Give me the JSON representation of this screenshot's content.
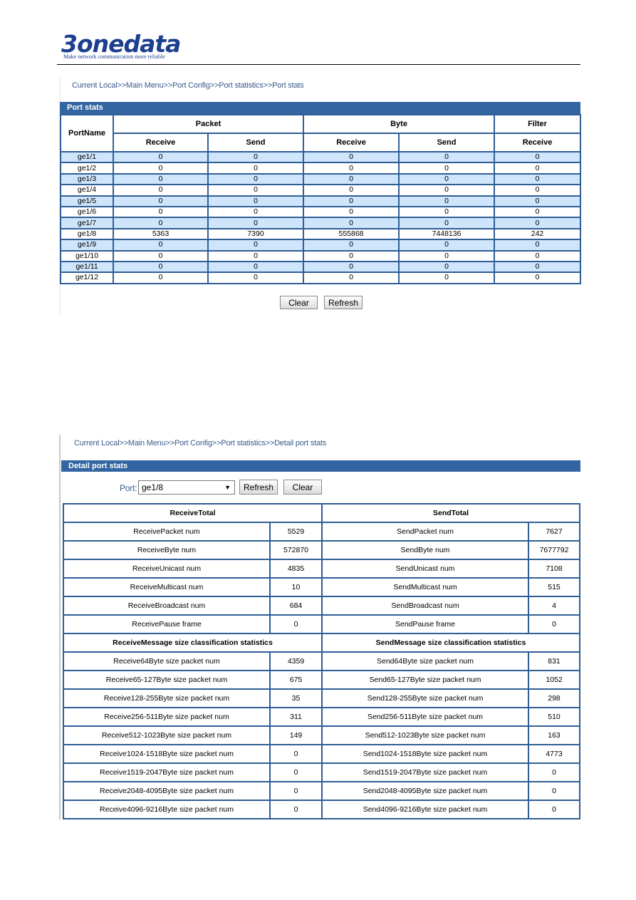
{
  "logo": {
    "brand": "3onedata",
    "tagline": "Make network communication more reliable"
  },
  "port_stats": {
    "breadcrumb": "Current Local>>Main Menu>>Port Config>>Port statistics>>Port stats",
    "title": "Port stats",
    "headers": {
      "port_name": "PortName",
      "packet": "Packet",
      "byte": "Byte",
      "filter": "Filter",
      "receive": "Receive",
      "send": "Send"
    },
    "rows": [
      [
        "ge1/1",
        "0",
        "0",
        "0",
        "0",
        "0"
      ],
      [
        "ge1/2",
        "0",
        "0",
        "0",
        "0",
        "0"
      ],
      [
        "ge1/3",
        "0",
        "0",
        "0",
        "0",
        "0"
      ],
      [
        "ge1/4",
        "0",
        "0",
        "0",
        "0",
        "0"
      ],
      [
        "ge1/5",
        "0",
        "0",
        "0",
        "0",
        "0"
      ],
      [
        "ge1/6",
        "0",
        "0",
        "0",
        "0",
        "0"
      ],
      [
        "ge1/7",
        "0",
        "0",
        "0",
        "0",
        "0"
      ],
      [
        "ge1/8",
        "5363",
        "7390",
        "555868",
        "7448136",
        "242"
      ],
      [
        "ge1/9",
        "0",
        "0",
        "0",
        "0",
        "0"
      ],
      [
        "ge1/10",
        "0",
        "0",
        "0",
        "0",
        "0"
      ],
      [
        "ge1/11",
        "0",
        "0",
        "0",
        "0",
        "0"
      ],
      [
        "ge1/12",
        "0",
        "0",
        "0",
        "0",
        "0"
      ]
    ],
    "clear_label": "Clear",
    "refresh_label": "Refresh"
  },
  "detail": {
    "breadcrumb": "Current Local>>Main Menu>>Port Config>>Port statistics>>Detail port stats",
    "title": "Detail port stats",
    "port_label": "Port:",
    "port_value": "ge1/8",
    "refresh_label": "Refresh",
    "clear_label": "Clear",
    "rows": [
      {
        "header": true,
        "left": "ReceiveTotal",
        "right": "SendTotal"
      },
      {
        "left": "ReceivePacket num",
        "lv": "5529",
        "right": "SendPacket num",
        "rv": "7627"
      },
      {
        "left": "ReceiveByte num",
        "lv": "572870",
        "right": "SendByte num",
        "rv": "7677792"
      },
      {
        "left": "ReceiveUnicast num",
        "lv": "4835",
        "right": "SendUnicast num",
        "rv": "7108"
      },
      {
        "left": "ReceiveMulticast num",
        "lv": "10",
        "right": "SendMulticast num",
        "rv": "515"
      },
      {
        "left": "ReceiveBroadcast num",
        "lv": "684",
        "right": "SendBroadcast num",
        "rv": "4"
      },
      {
        "left": "ReceivePause frame",
        "lv": "0",
        "right": "SendPause frame",
        "rv": "0"
      },
      {
        "header": true,
        "left": "ReceiveMessage size classification statistics",
        "right": "SendMessage size classification statistics"
      },
      {
        "left": "Receive64Byte size packet num",
        "lv": "4359",
        "right": "Send64Byte size packet num",
        "rv": "831"
      },
      {
        "left": "Receive65-127Byte size packet num",
        "lv": "675",
        "right": "Send65-127Byte size packet num",
        "rv": "1052"
      },
      {
        "left": "Receive128-255Byte size packet num",
        "lv": "35",
        "right": "Send128-255Byte size packet num",
        "rv": "298"
      },
      {
        "left": "Receive256-511Byte size packet num",
        "lv": "311",
        "right": "Send256-511Byte size packet num",
        "rv": "510"
      },
      {
        "left": "Receive512-1023Byte size packet num",
        "lv": "149",
        "right": "Send512-1023Byte size packet num",
        "rv": "163"
      },
      {
        "left": "Receive1024-1518Byte size packet num",
        "lv": "0",
        "right": "Send1024-1518Byte size packet num",
        "rv": "4773"
      },
      {
        "left": "Receive1519-2047Byte size packet num",
        "lv": "0",
        "right": "Send1519-2047Byte size packet num",
        "rv": "0"
      },
      {
        "left": "Receive2048-4095Byte size packet num",
        "lv": "0",
        "right": "Send2048-4095Byte size packet num",
        "rv": "0"
      },
      {
        "left": "Receive4096-9216Byte size packet num",
        "lv": "0",
        "right": "Send4096-9216Byte size packet num",
        "rv": "0"
      }
    ]
  },
  "colors": {
    "header_bar": "#3365a2",
    "border": "#2f5e96",
    "alt_row": "#cfe5fb",
    "brand": "#1d3f8f"
  }
}
